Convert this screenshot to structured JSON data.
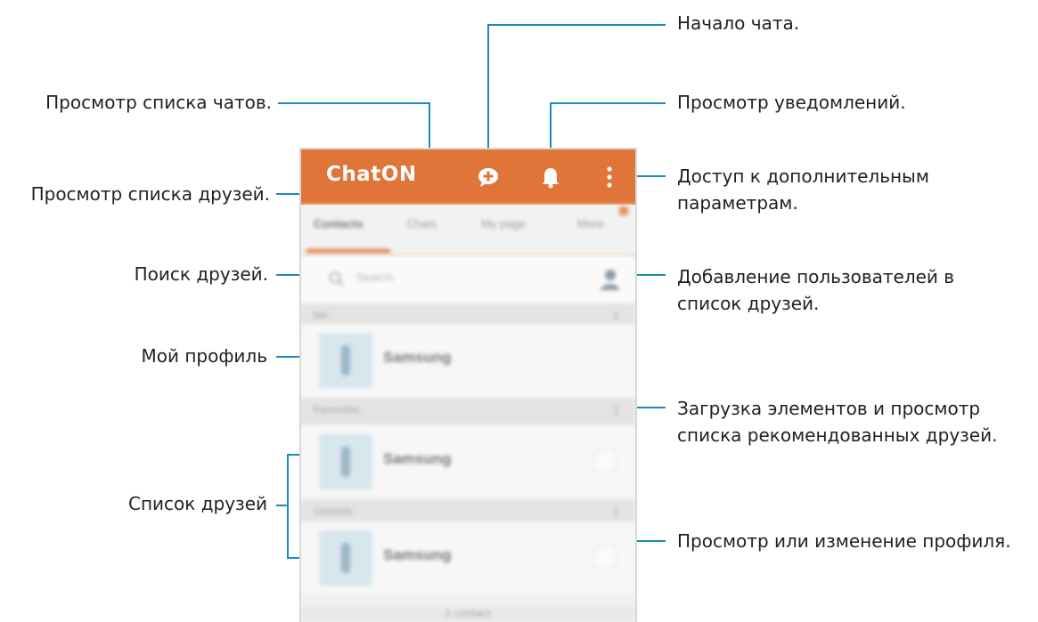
{
  "callouts": {
    "start_chat": "Начало чата.",
    "chat_list": "Просмотр списка чатов.",
    "notifications": "Просмотр уведомлений.",
    "more_options_line1": "Доступ к дополнительным",
    "more_options_line2": "параметрам.",
    "friends_list_view": "Просмотр списка друзей.",
    "search_friends": "Поиск друзей.",
    "add_users_line1": "Добавление пользователей в",
    "add_users_line2": "список друзей.",
    "my_profile": "Мой профиль",
    "download_line1": "Загрузка элементов и просмотр",
    "download_line2": "списка рекомендованных друзей.",
    "friends_list": "Список друзей",
    "profile_edit": "Просмотр или изменение профиля."
  },
  "app": {
    "title": "ChatON",
    "tabs": [
      "Contacts",
      "Chats",
      "My page",
      "More"
    ],
    "active_tab": 0,
    "search_placeholder": "Search",
    "sections": [
      {
        "label": "Me",
        "count": "1"
      },
      {
        "label": "Favourites",
        "count": "1"
      },
      {
        "label": "Contacts",
        "count": "1"
      }
    ],
    "rows": [
      {
        "name": "Samsung"
      },
      {
        "name": "Samsung"
      },
      {
        "name": "Samsung"
      }
    ],
    "footer": "1 contact",
    "colors": {
      "accent": "#e0753a",
      "callout_line": "#1a8ac0"
    }
  },
  "icons": {
    "compose": "compose-chat-icon",
    "bell": "bell-icon",
    "overflow": "overflow-menu-icon",
    "search": "search-icon",
    "add_contact": "add-contact-icon"
  }
}
